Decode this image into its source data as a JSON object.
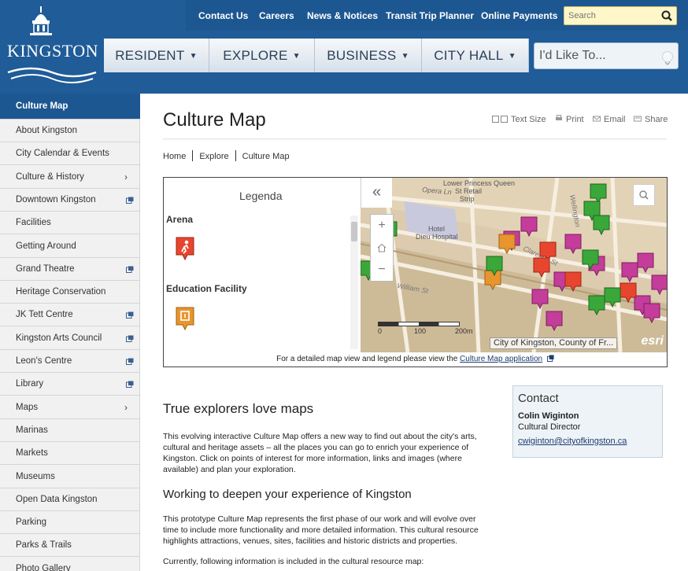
{
  "brand": {
    "logo_text": "KINGSTON"
  },
  "utility_nav": [
    "Contact Us",
    "Careers",
    "News & Notices",
    "Transit Trip Planner",
    "Online Payments"
  ],
  "search": {
    "placeholder": "Search"
  },
  "main_nav": [
    "RESIDENT",
    "EXPLORE",
    "BUSINESS",
    "CITY HALL"
  ],
  "like_dropdown": "I'd Like To...",
  "sidebar": [
    {
      "label": "Culture Map",
      "active": true
    },
    {
      "label": "About Kingston"
    },
    {
      "label": "City Calendar & Events"
    },
    {
      "label": "Culture & History",
      "submenu": true
    },
    {
      "label": "Downtown Kingston",
      "external": true
    },
    {
      "label": "Facilities"
    },
    {
      "label": "Getting Around"
    },
    {
      "label": "Grand Theatre",
      "external": true
    },
    {
      "label": "Heritage Conservation"
    },
    {
      "label": "JK Tett Centre",
      "external": true
    },
    {
      "label": "Kingston Arts Council",
      "external": true
    },
    {
      "label": "Leon's Centre",
      "external": true
    },
    {
      "label": "Library",
      "external": true
    },
    {
      "label": "Maps",
      "submenu": true
    },
    {
      "label": "Marinas"
    },
    {
      "label": "Markets"
    },
    {
      "label": "Museums"
    },
    {
      "label": "Open Data Kingston"
    },
    {
      "label": "Parking"
    },
    {
      "label": "Parks & Trails"
    },
    {
      "label": "Photo Gallery"
    }
  ],
  "page": {
    "title": "Culture Map",
    "tools": [
      "Text Size",
      "Print",
      "Email",
      "Share"
    ],
    "breadcrumb": [
      "Home",
      "Explore",
      "Culture Map"
    ]
  },
  "map": {
    "legend_title": "Legenda",
    "legend_items": [
      "Arena",
      "Education Facility"
    ],
    "street_labels": [
      "Lower Princess Queen St Retail Strip",
      "Hotel Dieu Hospital",
      "Opera Ln",
      "William St",
      "Clarence St",
      "Wellington"
    ],
    "scale_labels": [
      "0",
      "100",
      "200m"
    ],
    "attribution": "City of Kingston, County of Fr...",
    "esri": "esri",
    "footer_text": "For a detailed map view and legend please view the ",
    "footer_link": "Culture Map application",
    "colors": {
      "arena": "#e8452f",
      "education": "#e8952f",
      "heritage": "#c43d9a",
      "park": "#3aa73a"
    }
  },
  "content": {
    "heading1": "True explorers love maps",
    "para1": "This evolving interactive Culture Map offers a new way to find out about the city's arts, cultural and heritage assets – all the places you can go to enrich your experience of Kingston. Click on points of interest for more information, links and images (where available) and plan your exploration.",
    "heading2": "Working to deepen your experience of Kingston",
    "para2": "This prototype Culture Map represents the first phase of our work and will evolve over time to include more functionality and more detailed information. This cultural resource highlights attractions, venues, sites, facilities and historic districts and properties.",
    "para3": "Currently, following information is included in the cultural resource map:"
  },
  "contact": {
    "heading": "Contact",
    "name": "Colin Wiginton",
    "role": "Cultural Director",
    "email": "cwiginton@cityofkingston.ca"
  }
}
